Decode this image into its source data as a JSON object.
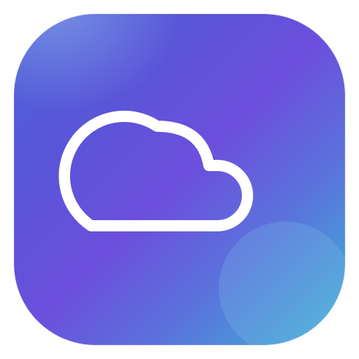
{
  "app_icon": {
    "glyph": "cloud-icon",
    "colors": {
      "gradient_start": "#4b62d9",
      "gradient_mid": "#6c4fdc",
      "gradient_end": "#49b6d9",
      "glyph_stroke": "#ffffff"
    }
  }
}
